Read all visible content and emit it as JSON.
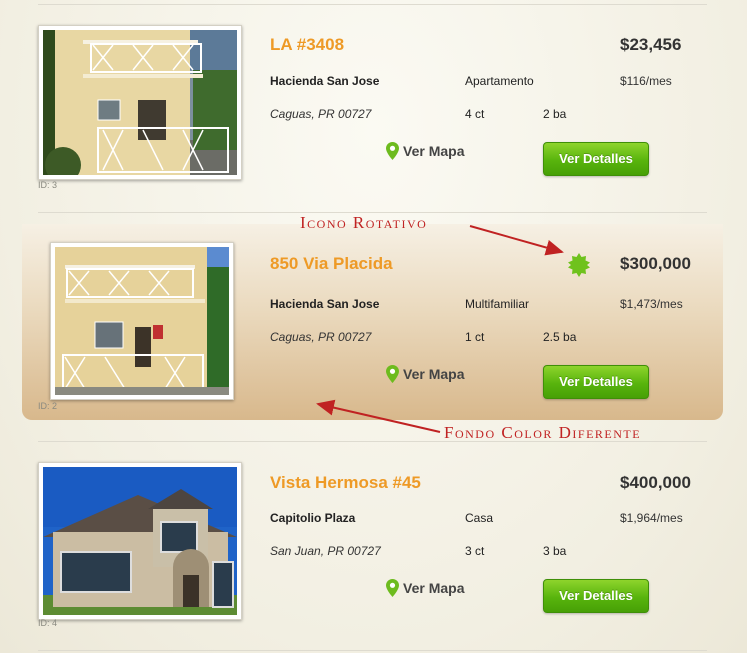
{
  "listings": [
    {
      "id_label": "ID: 3",
      "title": "LA #3408",
      "price": "$23,456",
      "community": "Hacienda San Jose",
      "type": "Apartamento",
      "monthly": "$116/mes",
      "city": "Caguas, PR 00727",
      "bedrooms": "4 ct",
      "bathrooms": "2 ba",
      "map_label": "Ver Mapa",
      "details_label": "Ver Detalles"
    },
    {
      "id_label": "ID: 2",
      "title": "850 Via Placida",
      "price": "$300,000",
      "community": "Hacienda San Jose",
      "type": "Multifamiliar",
      "monthly": "$1,473/mes",
      "city": "Caguas, PR 00727",
      "bedrooms": "1 ct",
      "bathrooms": "2.5 ba",
      "map_label": "Ver Mapa",
      "details_label": "Ver Detalles"
    },
    {
      "id_label": "ID: 4",
      "title": "Vista Hermosa #45",
      "price": "$400,000",
      "community": "Capitolio Plaza",
      "type": "Casa",
      "monthly": "$1,964/mes",
      "city": "San Juan, PR 00727",
      "bedrooms": "3 ct",
      "bathrooms": "3 ba",
      "map_label": "Ver Mapa",
      "details_label": "Ver Detalles"
    }
  ],
  "annotations": {
    "rotating_icon": "Icono Rotativo",
    "different_bg": "Fondo Color Diferente"
  },
  "colors": {
    "title": "#ee9a26",
    "button": "#58b40d",
    "annotation": "#c02222",
    "featured_bg": "#d8b88c"
  },
  "icons": [
    "map-pin-icon",
    "rotating-badge-icon"
  ]
}
